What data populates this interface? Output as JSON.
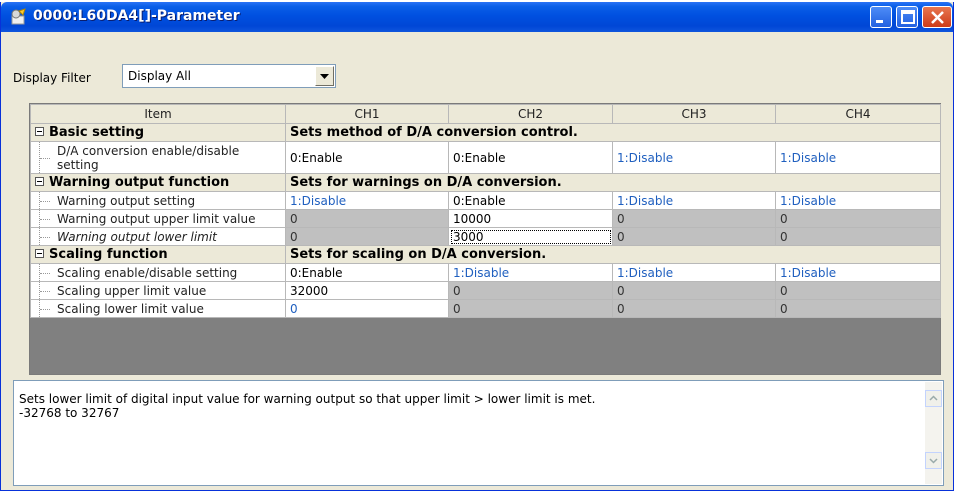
{
  "window": {
    "title": "0000:L60DA4[]-Parameter"
  },
  "filter": {
    "label": "Display Filter",
    "value": "Display All"
  },
  "grid": {
    "headers": [
      "Item",
      "CH1",
      "CH2",
      "CH3",
      "CH4"
    ],
    "groups": [
      {
        "name": "Basic setting",
        "desc": "Sets method of D/A conversion control.",
        "rows": [
          {
            "item": "D/A conversion enable/disable setting",
            "ch": [
              "0:Enable",
              "0:Enable",
              "1:Disable",
              "1:Disable"
            ]
          }
        ]
      },
      {
        "name": "Warning output function",
        "desc": "Sets for warnings on D/A conversion.",
        "rows": [
          {
            "item": "Warning output setting",
            "ch": [
              "1:Disable",
              "0:Enable",
              "1:Disable",
              "1:Disable"
            ]
          },
          {
            "item": "Warning output upper limit value",
            "ch": [
              "0",
              "10000",
              "0",
              "0"
            ]
          },
          {
            "item": "Warning output lower limit",
            "ch": [
              "0",
              "3000",
              "0",
              "0"
            ]
          }
        ]
      },
      {
        "name": "Scaling function",
        "desc": "Sets for scaling on D/A conversion.",
        "rows": [
          {
            "item": "Scaling enable/disable setting",
            "ch": [
              "0:Enable",
              "1:Disable",
              "1:Disable",
              "1:Disable"
            ]
          },
          {
            "item": "Scaling upper limit value",
            "ch": [
              "32000",
              "0",
              "0",
              "0"
            ]
          },
          {
            "item": "Scaling lower limit value",
            "ch": [
              "0",
              "0",
              "0",
              "0"
            ]
          }
        ]
      }
    ]
  },
  "description": {
    "line1": "Sets lower limit of digital input value for warning output so that upper limit > lower limit is met.",
    "line2": "-32768 to 32767"
  },
  "icons": {
    "title": "parameter-icon",
    "minimize": "minimize-icon",
    "maximize": "maximize-icon",
    "close": "close-icon",
    "dropdown": "chevron-down-icon",
    "scroll_up": "scroll-up-icon",
    "scroll_down": "scroll-down-icon"
  },
  "colors": {
    "titlebar": "#0050e0",
    "close_button": "#cd3b18",
    "blue_value": "#1f5fbf",
    "disabled_cell": "#c0c0c0"
  }
}
